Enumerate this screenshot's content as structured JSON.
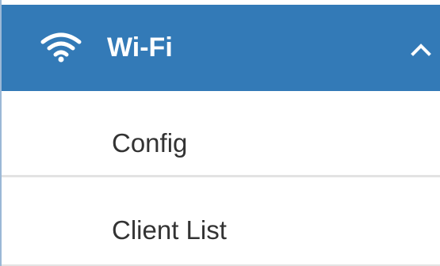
{
  "menu": {
    "header": {
      "icon": "wifi-icon",
      "title": "Wi-Fi",
      "toggle_icon": "chevron-up-icon",
      "background_color": "#337ab7",
      "text_color": "#ffffff"
    },
    "items": [
      {
        "label": "Config"
      },
      {
        "label": "Client List"
      }
    ]
  }
}
